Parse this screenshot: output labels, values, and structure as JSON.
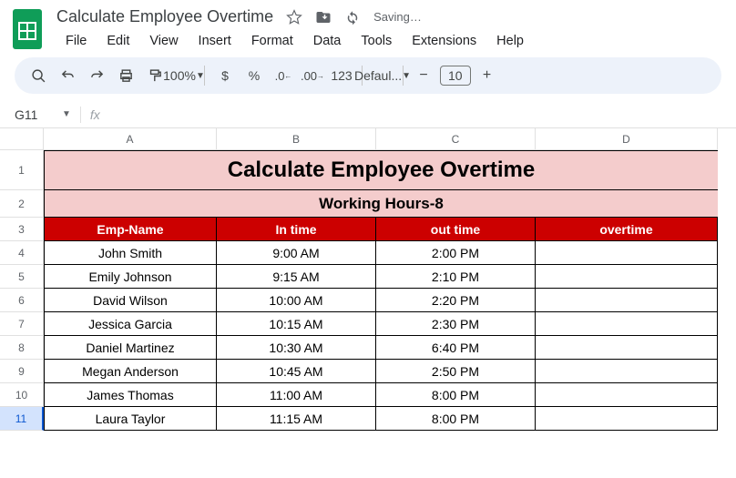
{
  "doc": {
    "title": "Calculate Employee Overtime",
    "saving": "Saving…"
  },
  "menu": {
    "file": "File",
    "edit": "Edit",
    "view": "View",
    "insert": "Insert",
    "format": "Format",
    "data": "Data",
    "tools": "Tools",
    "extensions": "Extensions",
    "help": "Help"
  },
  "tb": {
    "zoom": "100%",
    "currency": "$",
    "percent": "%",
    "dec_dec": ".0",
    "dec_inc": ".00",
    "num": "123",
    "font": "Defaul...",
    "minus": "−",
    "size": "10",
    "plus": "+"
  },
  "nbox": {
    "cell": "G11"
  },
  "cols": {
    "a": "A",
    "b": "B",
    "c": "C",
    "d": "D"
  },
  "rows": [
    "1",
    "2",
    "3",
    "4",
    "5",
    "6",
    "7",
    "8",
    "9",
    "10",
    "11"
  ],
  "sheet": {
    "title": "Calculate Employee Overtime",
    "subtitle": "Working Hours-8",
    "headers": {
      "a": "Emp-Name",
      "b": "In time",
      "c": "out time",
      "d": "overtime"
    },
    "data": [
      {
        "a": "John Smith",
        "b": "9:00 AM",
        "c": "2:00 PM",
        "d": ""
      },
      {
        "a": "Emily Johnson",
        "b": "9:15 AM",
        "c": "2:10 PM",
        "d": ""
      },
      {
        "a": "David Wilson",
        "b": "10:00 AM",
        "c": "2:20 PM",
        "d": ""
      },
      {
        "a": "Jessica Garcia",
        "b": "10:15 AM",
        "c": "2:30 PM",
        "d": ""
      },
      {
        "a": "Daniel Martinez",
        "b": "10:30 AM",
        "c": "6:40 PM",
        "d": ""
      },
      {
        "a": "Megan Anderson",
        "b": "10:45 AM",
        "c": "2:50 PM",
        "d": ""
      },
      {
        "a": "James Thomas",
        "b": "11:00 AM",
        "c": "8:00 PM",
        "d": ""
      },
      {
        "a": "Laura Taylor",
        "b": "11:15 AM",
        "c": "8:00 PM",
        "d": ""
      }
    ]
  }
}
